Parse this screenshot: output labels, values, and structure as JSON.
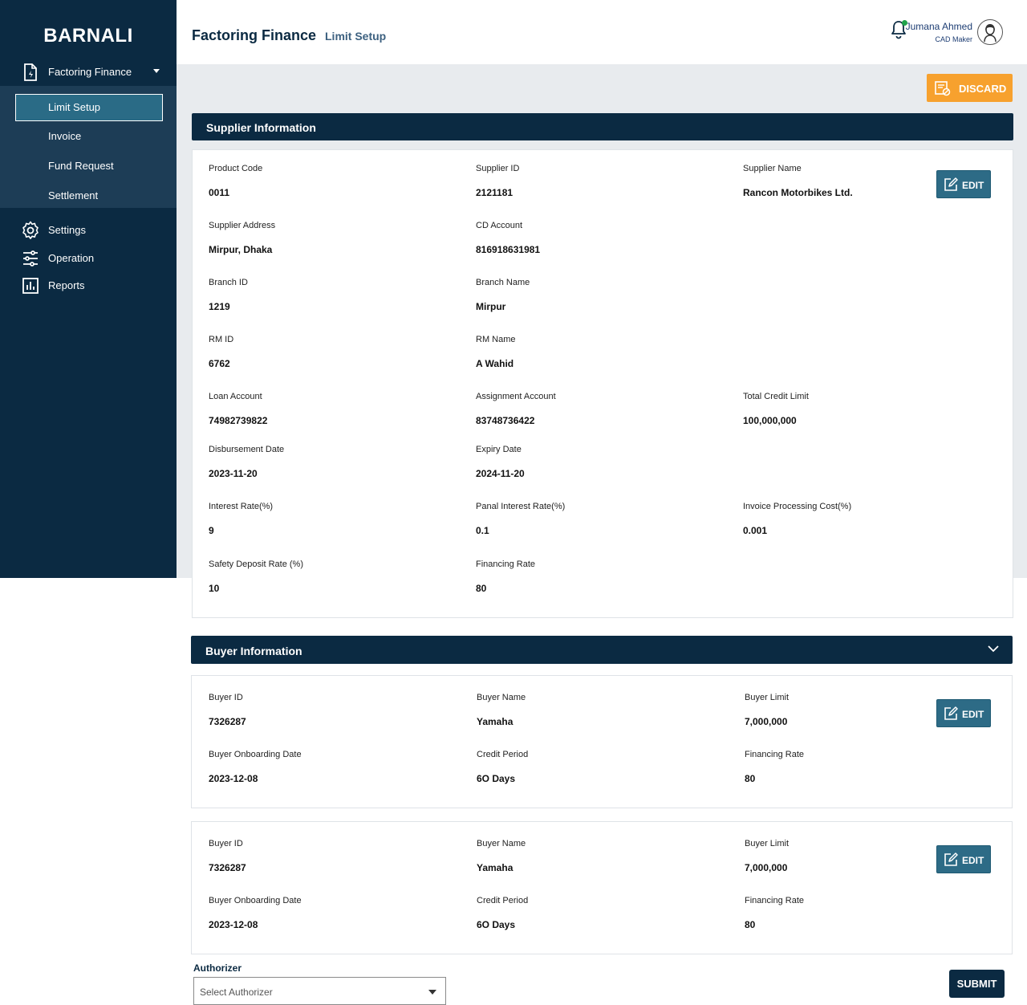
{
  "sidebar": {
    "brand": "BARNALI",
    "parent": {
      "label": "Factoring Finance",
      "icon": "document-icon"
    },
    "sub_items": [
      {
        "label": "Limit Setup",
        "active": true
      },
      {
        "label": "Invoice"
      },
      {
        "label": "Fund Request"
      },
      {
        "label": "Settlement"
      }
    ],
    "items": [
      {
        "label": "Settings",
        "icon": "gear-icon"
      },
      {
        "label": "Operation",
        "icon": "sliders-icon"
      },
      {
        "label": "Reports",
        "icon": "chart-icon"
      }
    ]
  },
  "header": {
    "title": "Factoring Finance",
    "breadcrumb": "Limit Setup",
    "user_name": "Jumana Ahmed",
    "user_role": "CAD Maker",
    "notification_dot_color": "#1fa34a"
  },
  "actions": {
    "discard": "DISCARD",
    "edit": "EDIT",
    "submit": "SUBMIT"
  },
  "supplier": {
    "heading": "Supplier Information",
    "fields": {
      "product_code": {
        "label": "Product Code",
        "value": "0011"
      },
      "supplier_id": {
        "label": "Supplier ID",
        "value": "2121181"
      },
      "supplier_name": {
        "label": "Supplier Name",
        "value": "Rancon Motorbikes Ltd."
      },
      "supplier_address": {
        "label": "Supplier Address",
        "value": "Mirpur, Dhaka"
      },
      "cd_account": {
        "label": "CD Account",
        "value": "816918631981"
      },
      "branch_id": {
        "label": "Branch ID",
        "value": "1219"
      },
      "branch_name": {
        "label": "Branch Name",
        "value": "Mirpur"
      },
      "rm_id": {
        "label": "RM ID",
        "value": "6762"
      },
      "rm_name": {
        "label": "RM Name",
        "value": "A Wahid"
      },
      "loan_account": {
        "label": "Loan Account",
        "value": "74982739822"
      },
      "assignment_account": {
        "label": "Assignment Account",
        "value": "83748736422"
      },
      "total_credit_limit": {
        "label": "Total Credit Limit",
        "value": "100,000,000"
      },
      "disbursement_date": {
        "label": "Disbursement Date",
        "value": "2023-11-20"
      },
      "expiry_date": {
        "label": "Expiry Date",
        "value": "2024-11-20"
      },
      "interest_rate": {
        "label": "Interest Rate(%)",
        "value": "9"
      },
      "panal_interest_rate": {
        "label": "Panal Interest Rate(%)",
        "value": "0.1"
      },
      "invoice_processing_cost": {
        "label": "Invoice Processing Cost(%)",
        "value": "0.001"
      },
      "safety_deposit_rate": {
        "label": "Safety Deposit Rate (%)",
        "value": "10"
      },
      "financing_rate": {
        "label": "Financing Rate",
        "value": "80"
      }
    }
  },
  "buyer": {
    "heading": "Buyer Information",
    "buyers": [
      {
        "buyer_id": {
          "label": "Buyer ID",
          "value": "7326287"
        },
        "buyer_name": {
          "label": "Buyer Name",
          "value": "Yamaha"
        },
        "buyer_limit": {
          "label": "Buyer Limit",
          "value": "7,000,000"
        },
        "onboarding_date": {
          "label": "Buyer Onboarding Date",
          "value": "2023-12-08"
        },
        "credit_period": {
          "label": "Credit Period",
          "value": "6O Days"
        },
        "financing_rate": {
          "label": "Financing Rate",
          "value": "80"
        }
      },
      {
        "buyer_id": {
          "label": "Buyer ID",
          "value": "7326287"
        },
        "buyer_name": {
          "label": "Buyer Name",
          "value": "Yamaha"
        },
        "buyer_limit": {
          "label": "Buyer Limit",
          "value": "7,000,000"
        },
        "onboarding_date": {
          "label": "Buyer Onboarding Date",
          "value": "2023-12-08"
        },
        "credit_period": {
          "label": "Credit Period",
          "value": "6O Days"
        },
        "financing_rate": {
          "label": "Financing Rate",
          "value": "80"
        }
      }
    ]
  },
  "authorizer": {
    "label": "Authorizer",
    "placeholder": "Select Authorizer"
  }
}
